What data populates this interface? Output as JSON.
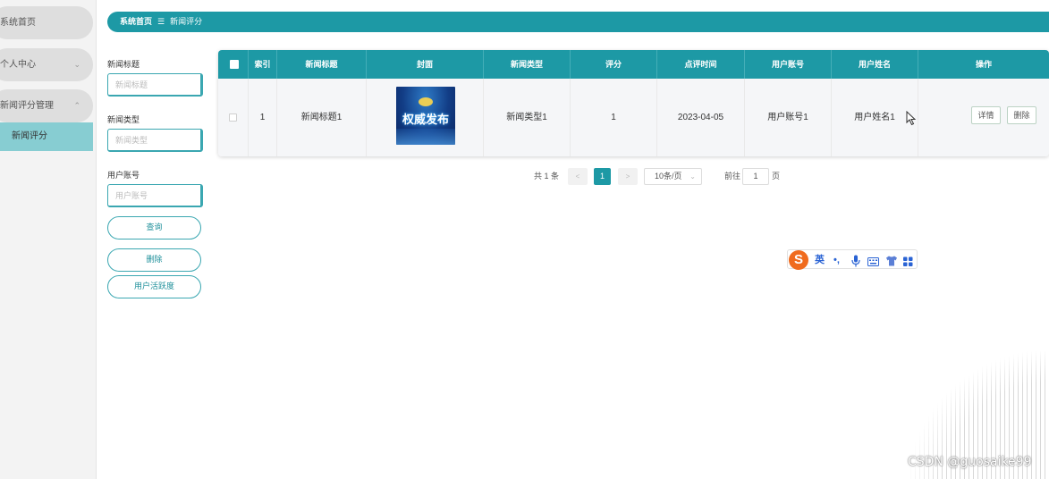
{
  "sidebar": {
    "items": [
      {
        "label": "系统首页"
      },
      {
        "label": "个人中心",
        "arrow": "⌄"
      },
      {
        "label": "新闻评分管理",
        "arrow": "⌃"
      }
    ],
    "sub_items": [
      {
        "label": "新闻评分"
      }
    ]
  },
  "breadcrumb": {
    "home": "系统首页",
    "separator": "☰",
    "current": "新闻评分"
  },
  "filters": {
    "title_label": "新闻标题",
    "title_placeholder": "新闻标题",
    "type_label": "新闻类型",
    "type_placeholder": "新闻类型",
    "account_label": "用户账号",
    "account_placeholder": "用户账号"
  },
  "buttons": {
    "query": "查询",
    "delete": "删除",
    "activity": "用户活跃度"
  },
  "table": {
    "headers": [
      "索引",
      "新闻标题",
      "封面",
      "新闻类型",
      "评分",
      "点评时间",
      "用户账号",
      "用户姓名",
      "操作"
    ],
    "rows": [
      {
        "index": "1",
        "title": "新闻标题1",
        "cover_text": "权威发布",
        "type": "新闻类型1",
        "score": "1",
        "time": "2023-04-05",
        "account": "用户账号1",
        "name": "用户姓名1",
        "detail": "详情",
        "delete": "删除"
      }
    ]
  },
  "pagination": {
    "total": "共 1 条",
    "prev": "<",
    "current": "1",
    "next": ">",
    "page_size": "10条/页",
    "goto_label": "前往",
    "goto_value": "1",
    "page_suffix": "页"
  },
  "ime": {
    "logo": "S",
    "lang": "英",
    "punct": "•,",
    "mic": "🎤",
    "keyboard": "⌨",
    "skin": "👕",
    "apps": "▦"
  },
  "watermark": "CSDN @guosaike99",
  "colors": {
    "primary": "#1d99a5",
    "sidebar_active": "#87cdd2",
    "ime_orange": "#f06b1e"
  }
}
